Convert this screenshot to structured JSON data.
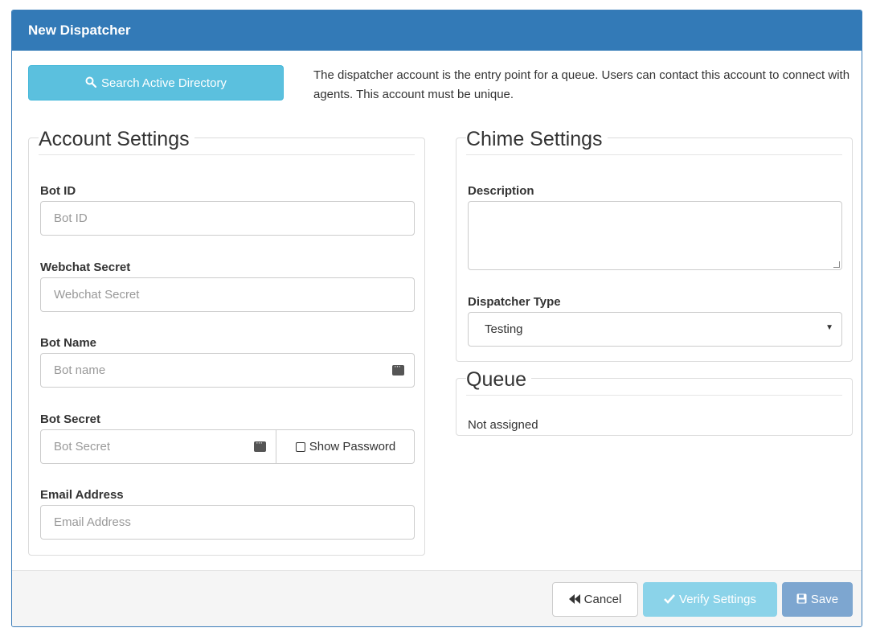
{
  "header": {
    "title": "New Dispatcher"
  },
  "search_ad": {
    "label": "Search Active Directory",
    "icon": "search-icon"
  },
  "intro_text": "The dispatcher account is the entry point for a queue. Users can contact this account to connect with agents. This account must be unique.",
  "account_settings": {
    "legend": "Account Settings",
    "bot_id": {
      "label": "Bot ID",
      "placeholder": "Bot ID",
      "value": ""
    },
    "webchat_secret": {
      "label": "Webchat Secret",
      "placeholder": "Webchat Secret",
      "value": ""
    },
    "bot_name": {
      "label": "Bot Name",
      "placeholder": "Bot name",
      "value": ""
    },
    "bot_secret": {
      "label": "Bot Secret",
      "placeholder": "Bot Secret",
      "value": "",
      "show_password_label": "Show Password",
      "show_password_checked": false
    },
    "email": {
      "label": "Email Address",
      "placeholder": "Email Address",
      "value": ""
    }
  },
  "chime_settings": {
    "legend": "Chime Settings",
    "description": {
      "label": "Description",
      "value": ""
    },
    "dispatcher_type": {
      "label": "Dispatcher Type",
      "selected": "Testing"
    }
  },
  "queue": {
    "legend": "Queue",
    "status": "Not assigned"
  },
  "footer": {
    "cancel_label": "Cancel",
    "verify_label": "Verify Settings",
    "save_label": "Save"
  },
  "colors": {
    "header_bg": "#337ab7",
    "info_button": "#5bc0de",
    "verify_button_disabled": "#8bd3e9",
    "save_button_disabled": "#7da6d0"
  }
}
